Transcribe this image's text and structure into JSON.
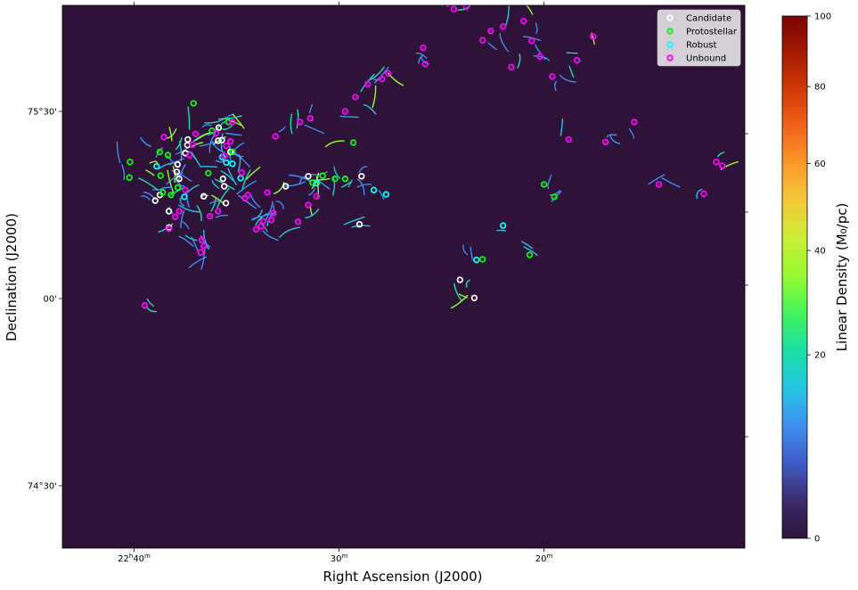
{
  "chart_data": {
    "type": "scatter",
    "xlabel": "Right Ascension (J2000)",
    "ylabel": "Declination (J2000)",
    "xlim_min": [
      343.5,
      310.2
    ],
    "ylim_arcmin": [
      4460,
      4547
    ],
    "x_ticks": [
      {
        "label_main": "22",
        "sup1": "h",
        "label_mid": "40",
        "sup2": "m",
        "ra_min": 340
      },
      {
        "label_main": "30",
        "sup1": "",
        "label_mid": "",
        "sup2": "m",
        "ra_min": 330
      },
      {
        "label_main": "20",
        "sup1": "",
        "label_mid": "",
        "sup2": "m",
        "ra_min": 320
      }
    ],
    "y_ticks": [
      {
        "label": "75°30'",
        "dec_arcmin": 4530
      },
      {
        "label": "00'",
        "dec_arcmin": 4500
      },
      {
        "label": "74°30'",
        "dec_arcmin": 4470
      }
    ],
    "background": "#2e1238",
    "colorbar": {
      "label": "Linear Density (M₀/pc)",
      "ticks": [
        "0",
        "20",
        "40",
        "60",
        "80",
        "100"
      ],
      "tick_values": [
        0,
        20,
        40,
        60,
        80,
        100
      ],
      "colors": [
        "#2e1238",
        "#3b2a6b",
        "#3f5bc4",
        "#3f8ef0",
        "#25c4e3",
        "#1bdfaa",
        "#41f35d",
        "#95fb32",
        "#c7ef34",
        "#f4cc3a",
        "#fc9b2c",
        "#f0651b",
        "#d23a08",
        "#a51a01",
        "#7a0403"
      ]
    },
    "legend_position": "top-right",
    "series": [
      {
        "name": "Candidate",
        "color": "#ffffff",
        "points": [
          [
            338.97,
            4515.7
          ],
          [
            338.74,
            4516.6
          ],
          [
            338.3,
            4514.0
          ],
          [
            338.3,
            4511.4
          ],
          [
            337.92,
            4520.3
          ],
          [
            337.88,
            4521.5
          ],
          [
            337.8,
            4519.2
          ],
          [
            337.5,
            4523.3
          ],
          [
            337.4,
            4524.6
          ],
          [
            337.38,
            4525.5
          ],
          [
            336.6,
            4516.4
          ],
          [
            335.9,
            4525.3
          ],
          [
            335.87,
            4527.4
          ],
          [
            335.72,
            4525.4
          ],
          [
            335.66,
            4519.2
          ],
          [
            335.6,
            4518.0
          ],
          [
            335.52,
            4515.3
          ],
          [
            335.3,
            4523.5
          ],
          [
            332.6,
            4518.0
          ],
          [
            331.5,
            4519.6
          ],
          [
            329.0,
            4511.9
          ],
          [
            324.1,
            4503.0
          ],
          [
            323.4,
            4500.1
          ],
          [
            328.9,
            4519.6
          ]
        ]
      },
      {
        "name": "Protostellar",
        "color": "#00ff00",
        "points": [
          [
            340.2,
            4521.9
          ],
          [
            340.23,
            4519.4
          ],
          [
            338.71,
            4519.7
          ],
          [
            338.6,
            4517.0
          ],
          [
            338.2,
            4516.6
          ],
          [
            338.75,
            4523.5
          ],
          [
            338.35,
            4523.0
          ],
          [
            337.87,
            4517.8
          ],
          [
            336.38,
            4520.1
          ],
          [
            336.2,
            4526.9
          ],
          [
            335.4,
            4528.3
          ],
          [
            335.2,
            4523.5
          ],
          [
            331.3,
            4518.6
          ],
          [
            330.8,
            4519.7
          ],
          [
            330.2,
            4519.2
          ],
          [
            329.7,
            4519.2
          ],
          [
            329.3,
            4525.0
          ],
          [
            323.0,
            4506.3
          ],
          [
            320.0,
            4518.3
          ],
          [
            319.5,
            4516.3
          ],
          [
            320.7,
            4507.0
          ],
          [
            337.1,
            4531.3
          ]
        ]
      },
      {
        "name": "Robust",
        "color": "#00ffff",
        "points": [
          [
            338.9,
            4521.2
          ],
          [
            337.55,
            4516.3
          ],
          [
            335.7,
            4522.7
          ],
          [
            335.5,
            4521.8
          ],
          [
            335.2,
            4521.6
          ],
          [
            334.8,
            4519.3
          ],
          [
            331.1,
            4518.5
          ],
          [
            328.3,
            4517.4
          ],
          [
            327.7,
            4516.7
          ],
          [
            323.3,
            4506.2
          ],
          [
            322.0,
            4511.7
          ]
        ]
      },
      {
        "name": "Unbound",
        "color": "#ff00ff",
        "points": [
          [
            339.48,
            4498.9
          ],
          [
            338.55,
            4525.9
          ],
          [
            338.3,
            4511.2
          ],
          [
            338.0,
            4513.1
          ],
          [
            337.8,
            4514.0
          ],
          [
            337.5,
            4517.4
          ],
          [
            337.3,
            4523.0
          ],
          [
            337.15,
            4524.7
          ],
          [
            337.0,
            4526.4
          ],
          [
            336.75,
            4507.4
          ],
          [
            336.7,
            4509.4
          ],
          [
            336.6,
            4508.4
          ],
          [
            336.3,
            4513.2
          ],
          [
            336.0,
            4526.5
          ],
          [
            335.9,
            4514.0
          ],
          [
            335.6,
            4522.9
          ],
          [
            335.5,
            4524.5
          ],
          [
            335.3,
            4525.2
          ],
          [
            335.2,
            4528.3
          ],
          [
            334.75,
            4520.2
          ],
          [
            334.6,
            4516.1
          ],
          [
            334.45,
            4516.6
          ],
          [
            334.05,
            4511.1
          ],
          [
            333.8,
            4511.6
          ],
          [
            333.7,
            4512.4
          ],
          [
            333.5,
            4517.0
          ],
          [
            333.3,
            4512.6
          ],
          [
            333.2,
            4513.7
          ],
          [
            333.1,
            4526.0
          ],
          [
            332.0,
            4512.3
          ],
          [
            331.9,
            4528.3
          ],
          [
            331.5,
            4515.0
          ],
          [
            331.1,
            4516.4
          ],
          [
            331.4,
            4528.9
          ],
          [
            329.7,
            4530.0
          ],
          [
            329.2,
            4532.3
          ],
          [
            328.6,
            4534.4
          ],
          [
            327.9,
            4535.2
          ],
          [
            327.6,
            4536.1
          ],
          [
            325.9,
            4540.2
          ],
          [
            325.8,
            4537.6
          ],
          [
            324.7,
            4547.3
          ],
          [
            324.4,
            4546.4
          ],
          [
            323.8,
            4546.8
          ],
          [
            323.0,
            4541.4
          ],
          [
            322.6,
            4542.9
          ],
          [
            322.5,
            4549.0
          ],
          [
            322.0,
            4543.6
          ],
          [
            321.6,
            4537.1
          ],
          [
            321.0,
            4544.5
          ],
          [
            320.6,
            4541.3
          ],
          [
            320.2,
            4538.8
          ],
          [
            319.6,
            4535.6
          ],
          [
            318.8,
            4525.5
          ],
          [
            318.4,
            4538.2
          ],
          [
            317.6,
            4542.0
          ],
          [
            317.0,
            4525.1
          ],
          [
            315.6,
            4528.3
          ],
          [
            314.4,
            4518.3
          ],
          [
            312.2,
            4516.8
          ],
          [
            311.6,
            4521.9
          ],
          [
            311.3,
            4521.3
          ]
        ]
      }
    ]
  }
}
